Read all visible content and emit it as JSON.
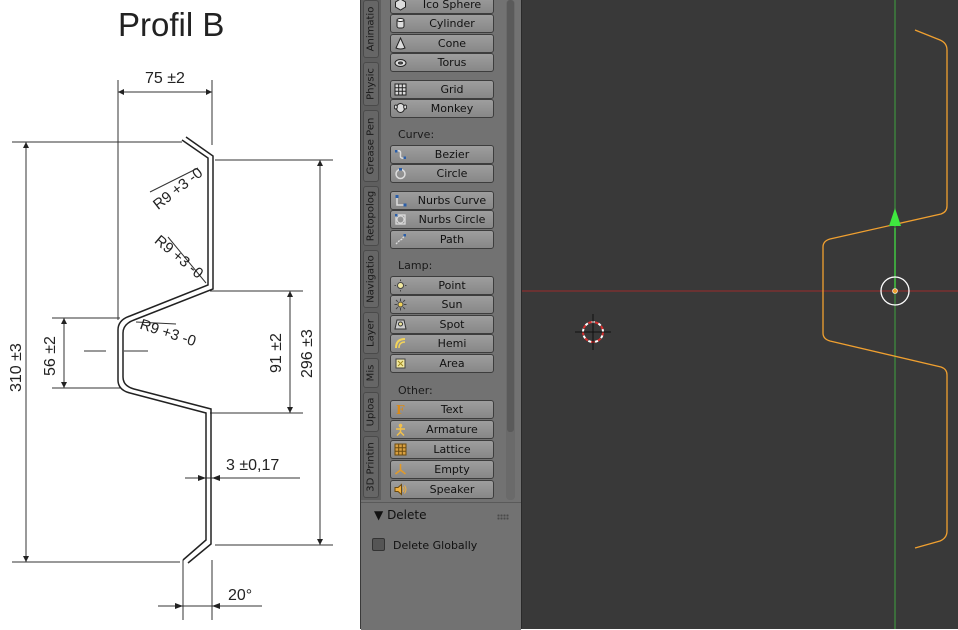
{
  "drawing": {
    "title": "Profil B",
    "dims": {
      "top_width": "75 ±2",
      "total_height": "310 ±3",
      "right_height": "296 ±3",
      "middle_height": "91 ±2",
      "left_height": "56 ±2",
      "thickness": "3 ±0,17",
      "angle": "20°",
      "radius_1": "R9 +3 -0",
      "radius_2": "R9 +3 -0",
      "radius_3": "R9 +3 -0"
    }
  },
  "shelf": {
    "tabs": [
      "Animatio",
      "Physic",
      "Grease Pen",
      "Retopolog",
      "Navigatio",
      "Layer",
      "Mis",
      "Uploa",
      "3D Printin"
    ],
    "sections": {
      "curve": "Curve:",
      "lamp": "Lamp:",
      "other": "Other:"
    },
    "mesh_buttons": [
      {
        "label": "Ico Sphere",
        "icon": "ico-sphere-icon"
      },
      {
        "label": "Cylinder",
        "icon": "cylinder-icon"
      },
      {
        "label": "Cone",
        "icon": "cone-icon"
      },
      {
        "label": "Torus",
        "icon": "torus-icon"
      },
      {
        "label": "Grid",
        "icon": "grid-icon"
      },
      {
        "label": "Monkey",
        "icon": "monkey-icon"
      }
    ],
    "curve_buttons": [
      {
        "label": "Bezier",
        "icon": "bezier-icon"
      },
      {
        "label": "Circle",
        "icon": "circle-curve-icon"
      },
      {
        "label": "Nurbs Curve",
        "icon": "nurbs-curve-icon"
      },
      {
        "label": "Nurbs Circle",
        "icon": "nurbs-circle-icon"
      },
      {
        "label": "Path",
        "icon": "path-icon"
      }
    ],
    "lamp_buttons": [
      {
        "label": "Point",
        "icon": "point-lamp-icon"
      },
      {
        "label": "Sun",
        "icon": "sun-lamp-icon"
      },
      {
        "label": "Spot",
        "icon": "spot-lamp-icon"
      },
      {
        "label": "Hemi",
        "icon": "hemi-lamp-icon"
      },
      {
        "label": "Area",
        "icon": "area-lamp-icon"
      }
    ],
    "other_buttons": [
      {
        "label": "Text",
        "icon": "text-icon"
      },
      {
        "label": "Armature",
        "icon": "armature-icon"
      },
      {
        "label": "Lattice",
        "icon": "lattice-icon"
      },
      {
        "label": "Empty",
        "icon": "empty-icon"
      },
      {
        "label": "Speaker",
        "icon": "speaker-icon"
      }
    ],
    "delete_panel": {
      "header": "Delete",
      "option": "Delete Globally",
      "checked": false
    }
  },
  "viewport": {
    "colors": {
      "background": "#393939",
      "x_axis": "#9b2a2a",
      "y_axis": "#3fa33f",
      "curve": "#f0a030"
    }
  }
}
